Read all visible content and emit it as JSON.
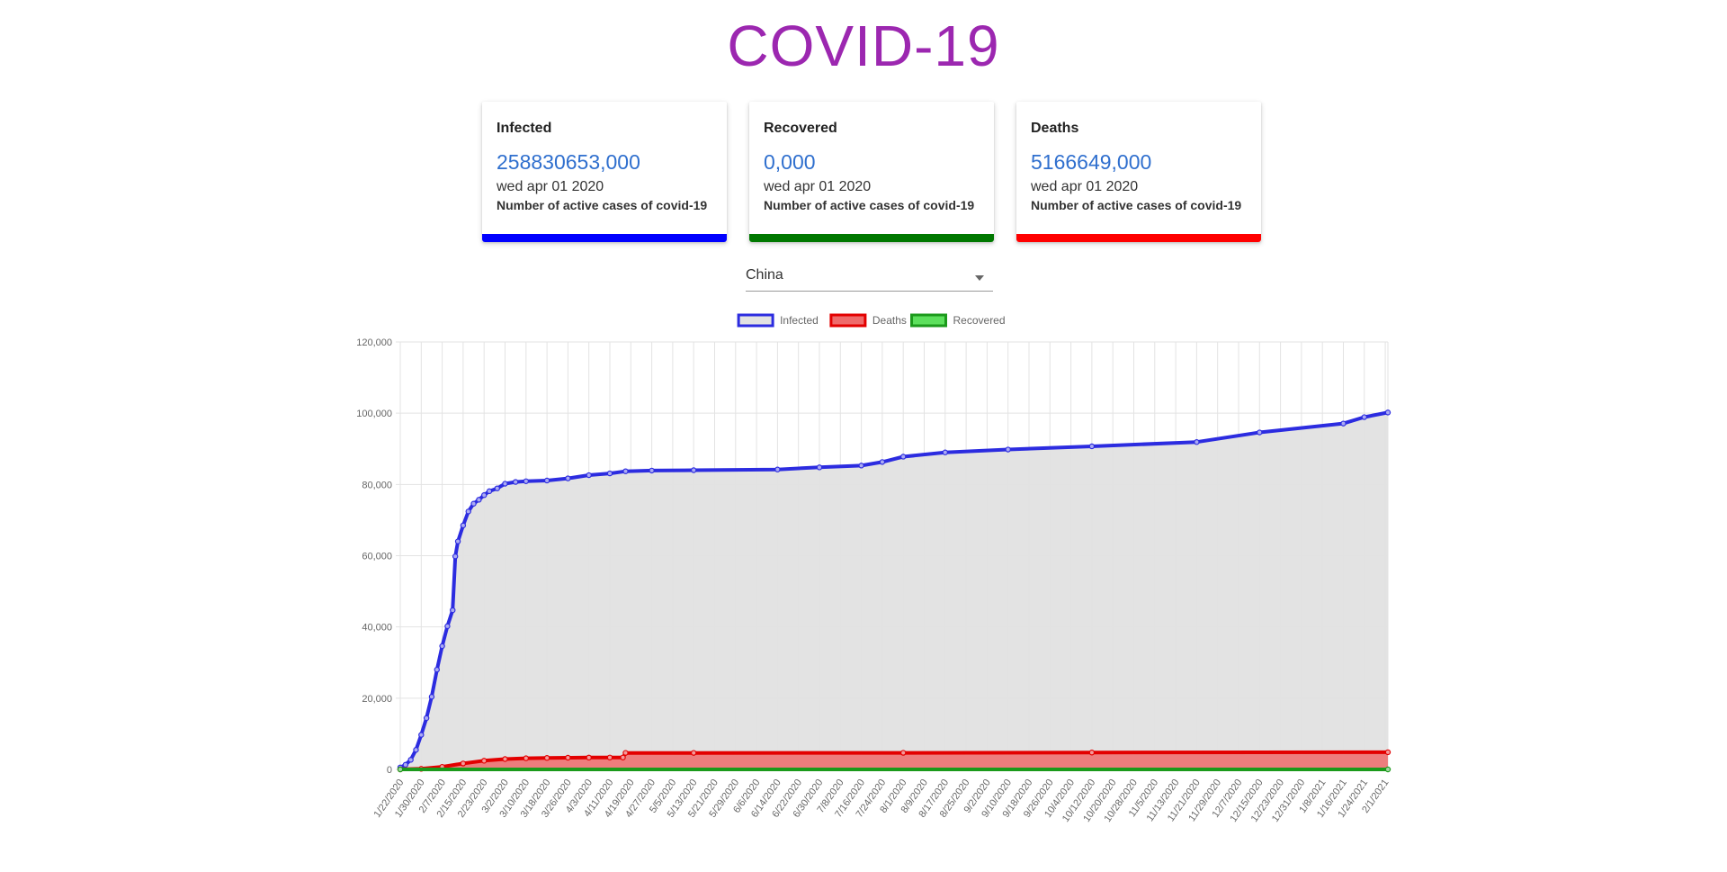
{
  "page": {
    "title": "COVID-19"
  },
  "cards": [
    {
      "label": "Infected",
      "value": "258830653,000",
      "date": "wed apr 01 2020",
      "desc": "Number of active cases of covid-19",
      "color": "#0000ff"
    },
    {
      "label": "Recovered",
      "value": "0,000",
      "date": "wed apr 01 2020",
      "desc": "Number of active cases of covid-19",
      "color": "#007800"
    },
    {
      "label": "Deaths",
      "value": "5166649,000",
      "date": "wed apr 01 2020",
      "desc": "Number of active cases of covid-19",
      "color": "#ff0000"
    }
  ],
  "country_select": {
    "selected": "China"
  },
  "icons": {
    "dropdown": "caret-down-icon"
  },
  "chart_data": {
    "type": "area",
    "legend_position": "top-center",
    "grid": true,
    "ylim": [
      0,
      120000
    ],
    "yticks": [
      0,
      20000,
      40000,
      60000,
      80000,
      100000,
      120000
    ],
    "ytick_labels": [
      "0",
      "20,000",
      "40,000",
      "60,000",
      "80,000",
      "100,000",
      "120,000"
    ],
    "xlim": [
      "1/22/2020",
      "2/2/2021"
    ],
    "xtick_labels": [
      "1/22/2020",
      "1/30/2020",
      "2/7/2020",
      "2/15/2020",
      "2/23/2020",
      "3/2/2020",
      "3/10/2020",
      "3/18/2020",
      "3/26/2020",
      "4/3/2020",
      "4/11/2020",
      "4/19/2020",
      "4/27/2020",
      "5/5/2020",
      "5/13/2020",
      "5/21/2020",
      "5/29/2020",
      "6/6/2020",
      "6/14/2020",
      "6/22/2020",
      "6/30/2020",
      "7/8/2020",
      "7/16/2020",
      "7/24/2020",
      "8/1/2020",
      "8/9/2020",
      "8/17/2020",
      "8/25/2020",
      "9/2/2020",
      "9/10/2020",
      "9/18/2020",
      "9/26/2020",
      "10/4/2020",
      "10/12/2020",
      "10/20/2020",
      "10/28/2020",
      "11/5/2020",
      "11/13/2020",
      "11/21/2020",
      "11/29/2020",
      "12/7/2020",
      "12/15/2020",
      "12/23/2020",
      "12/31/2020",
      "1/8/2021",
      "1/16/2021",
      "1/24/2021",
      "2/1/2021"
    ],
    "series": [
      {
        "name": "Infected",
        "color": "#2c2ce0",
        "fill": "#e2e2e2",
        "x": [
          "1/22/2020",
          "1/24/2020",
          "1/26/2020",
          "1/28/2020",
          "1/30/2020",
          "2/1/2020",
          "2/3/2020",
          "2/5/2020",
          "2/7/2020",
          "2/9/2020",
          "2/11/2020",
          "2/12/2020",
          "2/13/2020",
          "2/15/2020",
          "2/17/2020",
          "2/19/2020",
          "2/21/2020",
          "2/23/2020",
          "2/25/2020",
          "2/28/2020",
          "3/2/2020",
          "3/6/2020",
          "3/10/2020",
          "3/18/2020",
          "3/26/2020",
          "4/3/2020",
          "4/11/2020",
          "4/17/2020",
          "4/27/2020",
          "5/13/2020",
          "6/14/2020",
          "6/30/2020",
          "7/16/2020",
          "7/24/2020",
          "8/1/2020",
          "8/17/2020",
          "9/10/2020",
          "10/12/2020",
          "11/21/2020",
          "12/15/2020",
          "1/16/2021",
          "1/24/2021",
          "2/2/2021"
        ],
        "y": [
          550,
          1300,
          2700,
          5500,
          9700,
          14400,
          20400,
          28000,
          34600,
          40200,
          44700,
          59800,
          64000,
          68500,
          72400,
          74600,
          75700,
          77000,
          78100,
          78900,
          80200,
          80700,
          80900,
          81100,
          81700,
          82600,
          83100,
          83700,
          83900,
          84000,
          84200,
          84800,
          85300,
          86300,
          87800,
          89000,
          89800,
          90700,
          91900,
          94600,
          97100,
          98900,
          100200
        ]
      },
      {
        "name": "Deaths",
        "color": "#e30000",
        "fill": "#ef6b6b",
        "x": [
          "1/22/2020",
          "1/30/2020",
          "2/7/2020",
          "2/15/2020",
          "2/23/2020",
          "3/2/2020",
          "3/10/2020",
          "3/18/2020",
          "3/26/2020",
          "4/3/2020",
          "4/11/2020",
          "4/16/2020",
          "4/17/2020",
          "5/13/2020",
          "8/1/2020",
          "10/12/2020",
          "2/2/2021"
        ],
        "y": [
          17,
          170,
          720,
          1660,
          2440,
          2910,
          3130,
          3230,
          3290,
          3330,
          3340,
          3340,
          4630,
          4630,
          4660,
          4740,
          4820
        ]
      },
      {
        "name": "Recovered",
        "color": "#1b9a1b",
        "fill": "#5ce05c",
        "x": [
          "1/22/2020",
          "2/2/2021"
        ],
        "y": [
          0,
          0
        ]
      }
    ]
  }
}
